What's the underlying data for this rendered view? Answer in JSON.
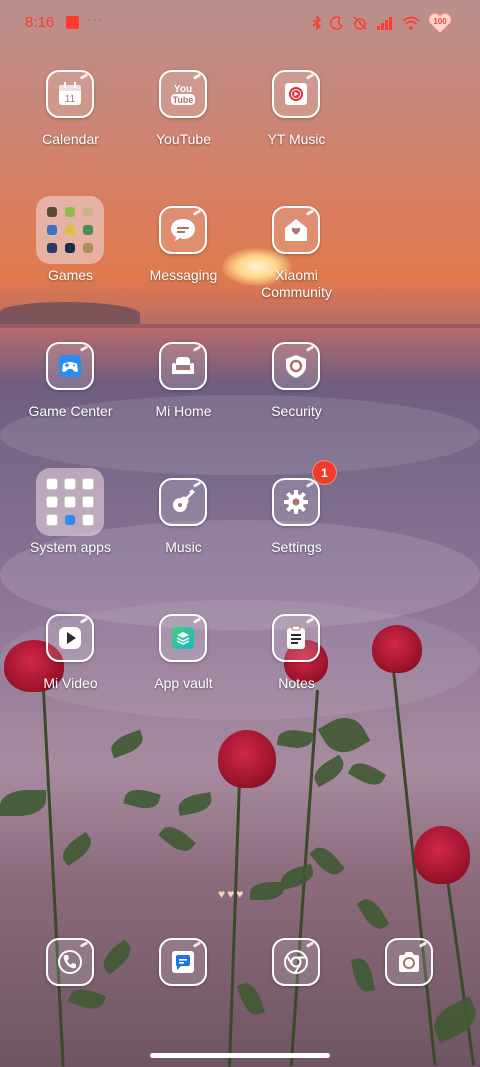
{
  "status_bar": {
    "time": "8:16",
    "dots": "···",
    "battery": "100",
    "icons": [
      "bluetooth-icon",
      "moon-icon",
      "alarm-icon",
      "signal-icon",
      "wifi-icon"
    ]
  },
  "apps": [
    {
      "name": "calendar",
      "label": "Calendar",
      "icon": "calendar-icon",
      "date": "11"
    },
    {
      "name": "youtube",
      "label": "YouTube",
      "icon": "youtube-icon",
      "text": "You\nTube"
    },
    {
      "name": "yt-music",
      "label": "YT Music",
      "icon": "yt-music-icon"
    },
    {
      "name": "games-folder",
      "label": "Games",
      "icon": "folder-icon"
    },
    {
      "name": "messaging",
      "label": "Messaging",
      "icon": "message-icon"
    },
    {
      "name": "xiaomi-community",
      "label": "Xiaomi\nCommunity",
      "icon": "community-icon"
    },
    {
      "name": "game-center",
      "label": "Game Center",
      "icon": "gamepad-icon"
    },
    {
      "name": "mi-home",
      "label": "Mi Home",
      "icon": "sofa-icon"
    },
    {
      "name": "security",
      "label": "Security",
      "icon": "shield-icon"
    },
    {
      "name": "system-apps-folder",
      "label": "System apps",
      "icon": "folder-icon"
    },
    {
      "name": "music",
      "label": "Music",
      "icon": "guitar-icon"
    },
    {
      "name": "settings",
      "label": "Settings",
      "icon": "gear-icon",
      "badge": "1"
    },
    {
      "name": "mi-video",
      "label": "Mi Video",
      "icon": "play-icon"
    },
    {
      "name": "app-vault",
      "label": "App vault",
      "icon": "layers-icon"
    },
    {
      "name": "notes",
      "label": "Notes",
      "icon": "notes-icon"
    }
  ],
  "hearts": "♥♥♥",
  "dock": [
    {
      "name": "phone",
      "icon": "phone-icon"
    },
    {
      "name": "messages",
      "icon": "chat-icon"
    },
    {
      "name": "chrome",
      "icon": "chrome-icon"
    },
    {
      "name": "camera",
      "icon": "camera-icon"
    }
  ],
  "colors": {
    "status": "#ff3b30",
    "badge": "#f23b2f",
    "icon_border": "#ffffff"
  }
}
